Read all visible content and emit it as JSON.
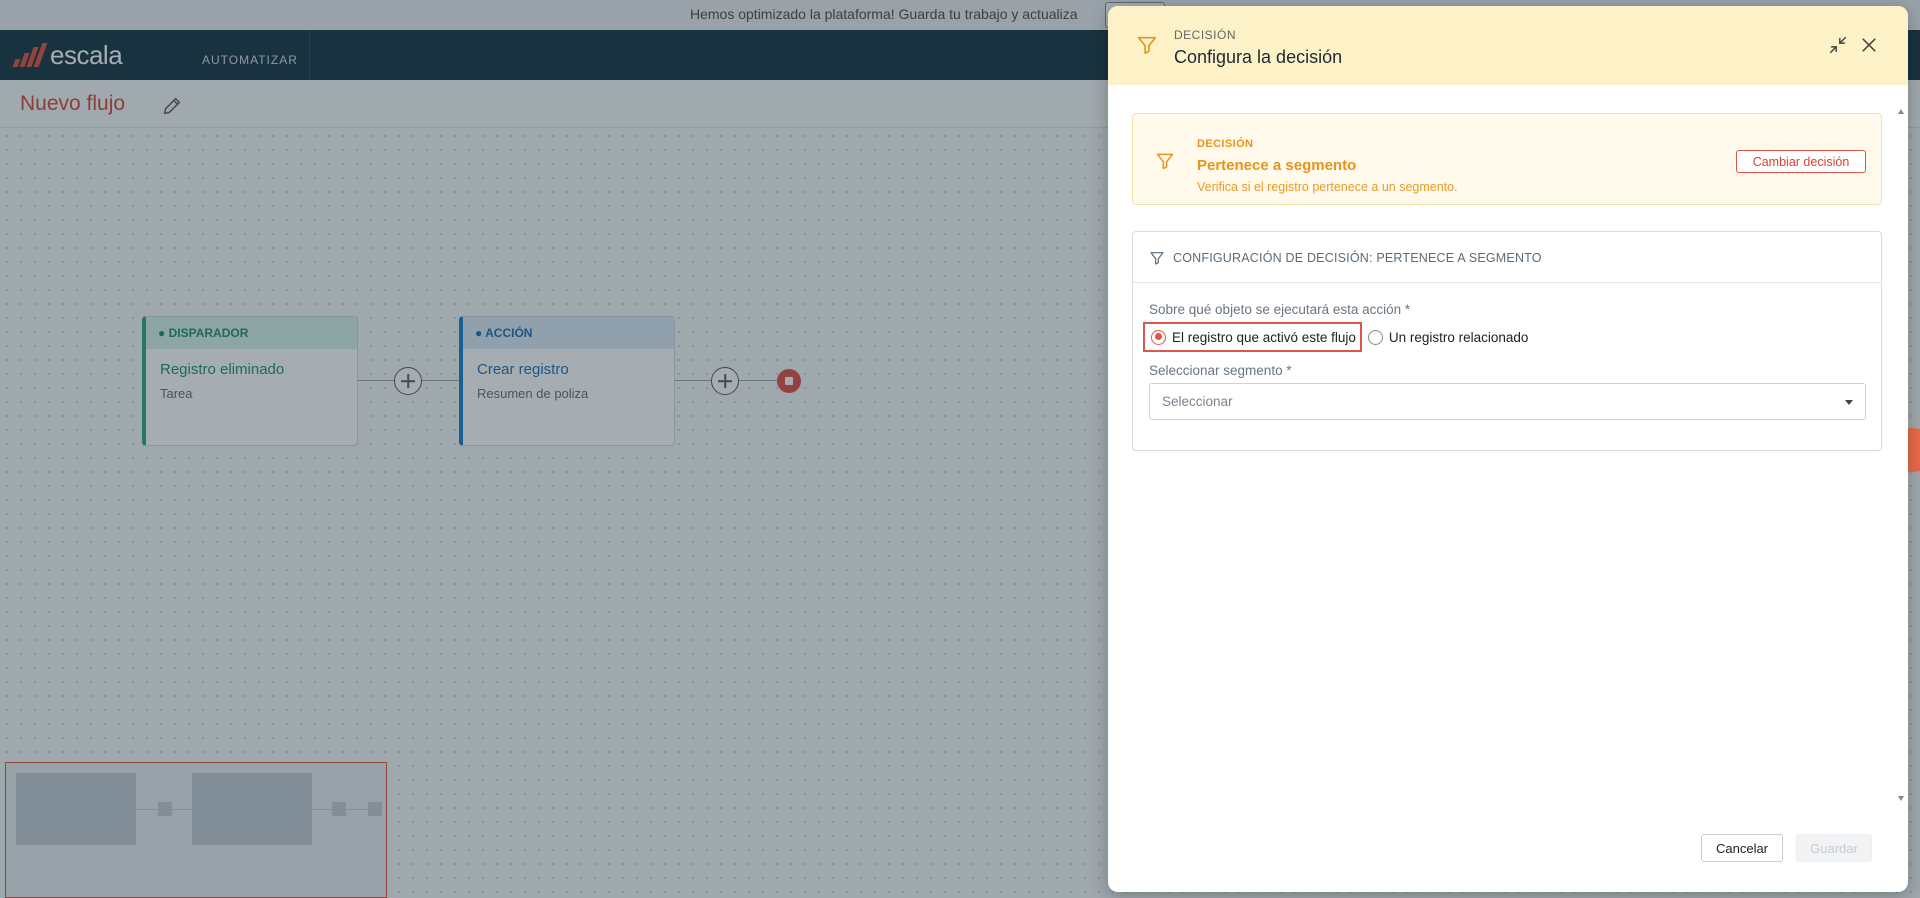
{
  "notice": {
    "text": "Hemos optimizado la plataforma! Guarda tu trabajo y actualiza"
  },
  "topnav": {
    "logo_text": "escala",
    "tab_label": "AUTOMATIZAR"
  },
  "flow": {
    "title": "Nuevo flujo"
  },
  "nodes": {
    "trigger": {
      "type_label": "DISPARADOR",
      "title": "Registro eliminado",
      "subtitle": "Tarea"
    },
    "action": {
      "type_label": "ACCIÓN",
      "title": "Crear registro",
      "subtitle": "Resumen de poliza"
    }
  },
  "panel": {
    "overline": "DECISIÓN",
    "title": "Configura la decisión",
    "decision_card": {
      "overline": "DECISIÓN",
      "title": "Pertenece a segmento",
      "description": "Verifica si el registro pertenece a un segmento.",
      "change_label": "Cambiar decisión"
    },
    "config": {
      "header": "CONFIGURACIÓN DE DECISIÓN: PERTENECE A SEGMENTO",
      "object_label": "Sobre qué objeto se ejecutará esta acción *",
      "options": [
        {
          "label": "El registro que activó este flujo",
          "selected": true
        },
        {
          "label": "Un registro relacionado",
          "selected": false
        }
      ],
      "segment_label": "Seleccionar segmento *",
      "segment_placeholder": "Seleccionar"
    },
    "footer": {
      "cancel_label": "Cancelar",
      "save_label": "Guardar"
    }
  },
  "colors": {
    "brand_red": "#d8412f",
    "nav_dark": "#0f2b3b",
    "trigger_green": "#1fa386",
    "action_blue": "#1677c9",
    "decision_orange": "#e8931a",
    "panel_header_yellow": "#fcf1c7"
  },
  "icons": {
    "edit": "pencil-icon",
    "filter": "funnel-icon",
    "collapse": "collapse-arrows-icon",
    "close": "close-icon",
    "add": "plus-circle-icon",
    "stop": "stop-icon",
    "chat": "chat-icon"
  }
}
